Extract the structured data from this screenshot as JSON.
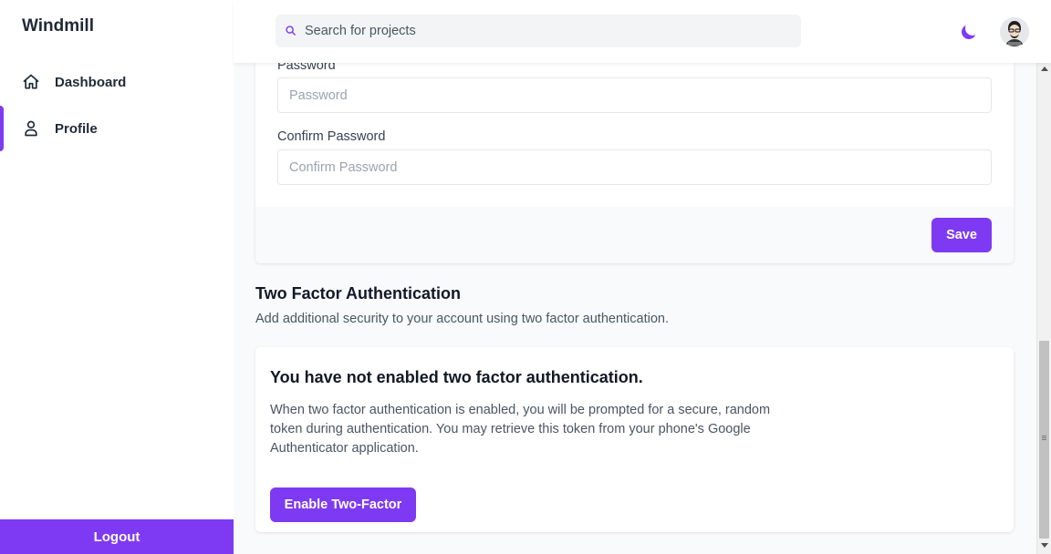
{
  "app": {
    "brand": "Windmill"
  },
  "sidebar": {
    "items": [
      {
        "label": "Dashboard",
        "icon": "home-icon",
        "active": false
      },
      {
        "label": "Profile",
        "icon": "user-icon",
        "active": true
      }
    ],
    "logout_label": "Logout"
  },
  "header": {
    "search": {
      "placeholder": "Search for projects",
      "value": ""
    },
    "theme_icon": "moon-icon",
    "avatar_icon": "avatar"
  },
  "password_form": {
    "password": {
      "label": "Password",
      "placeholder": "Password",
      "value": ""
    },
    "confirm": {
      "label": "Confirm Password",
      "placeholder": "Confirm Password",
      "value": ""
    },
    "save_label": "Save"
  },
  "two_factor": {
    "title": "Two Factor Authentication",
    "description": "Add additional security to your account using two factor authentication.",
    "status_heading": "You have not enabled two factor authentication.",
    "body": "When two factor authentication is enabled, you will be prompted for a secure, random token during authentication. You may retrieve this token from your phone's Google Authenticator application.",
    "enable_label": "Enable Two-Factor"
  },
  "colors": {
    "accent": "#7e3af2",
    "background": "#f9fafb",
    "text": "#1f2937"
  }
}
